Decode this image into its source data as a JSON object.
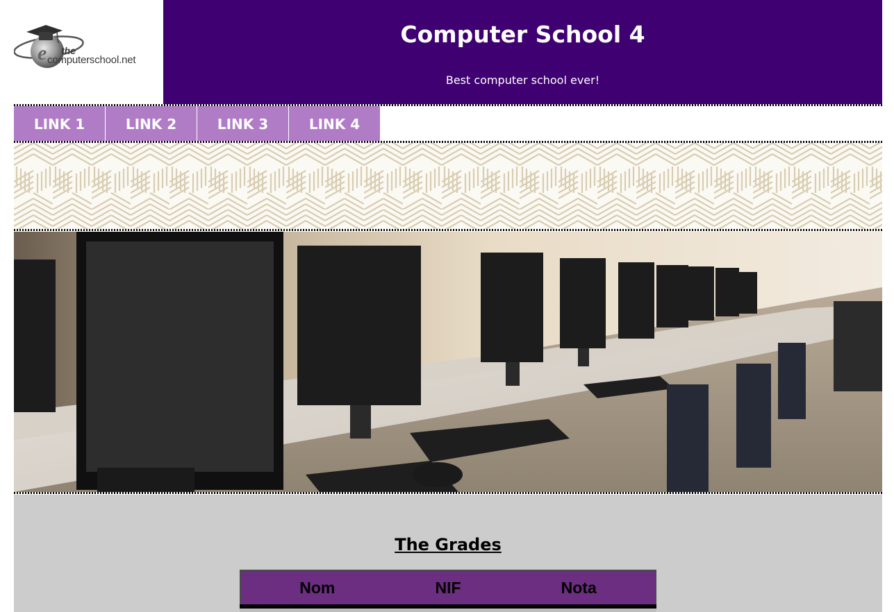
{
  "header": {
    "logo_line1": "the",
    "logo_line2": "computerschool.net",
    "title": "Computer School 4",
    "tagline": "Best computer school ever!"
  },
  "nav": {
    "links": [
      "LINK 1",
      "LINK 2",
      "LINK 3",
      "LINK 4"
    ]
  },
  "content": {
    "heading": "The Grades",
    "table_headers": [
      "Nom",
      "NIF",
      "Nota"
    ]
  },
  "colors": {
    "banner": "#3f0071",
    "nav": "#b07cc6",
    "table_header": "#6c2e80",
    "content_bg": "#cccccc"
  }
}
